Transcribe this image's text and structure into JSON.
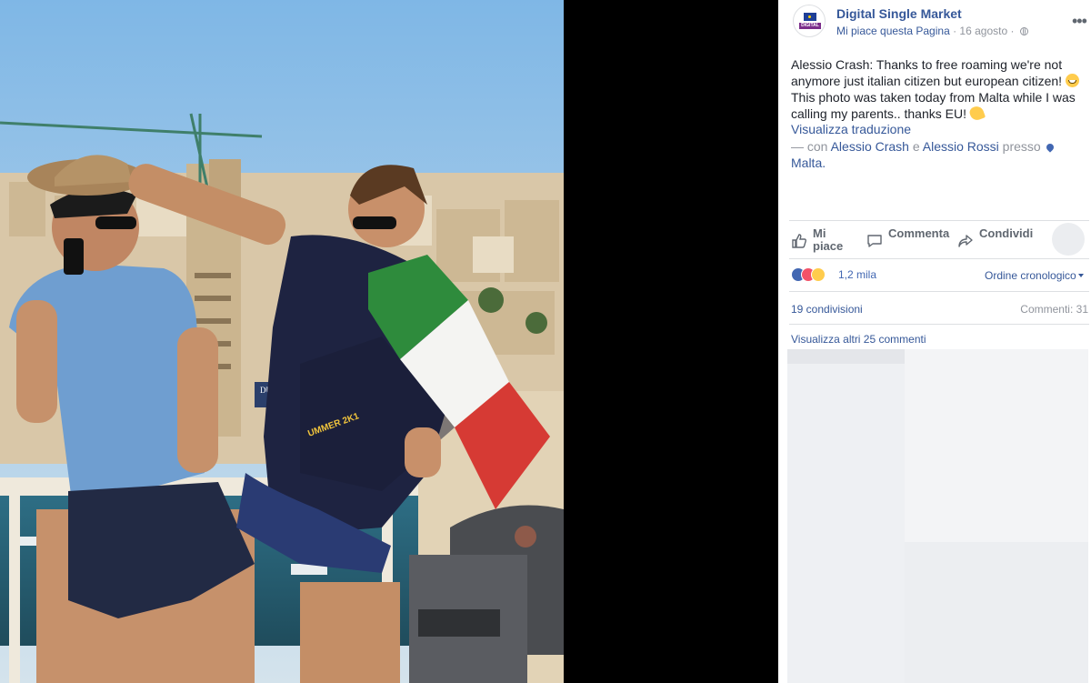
{
  "page": {
    "name": "Digital Single Market",
    "like_page": "Mi piace questa Pagina",
    "separator": " · ",
    "date": "16 agosto",
    "date_separator": " · ",
    "avatar_word": "DIGITAL"
  },
  "post": {
    "line1": "Alessio Crash: Thanks to free roaming we're not anymore just italian citizen but european citizen!",
    "line2": " This photo was taken today from Malta while I was calling my parents.. thanks EU! ",
    "translate": "Visualizza traduzione",
    "with_prefix": " — con ",
    "tag1": "Alessio Crash",
    "and": " e ",
    "tag2": "Alessio Rossi",
    "at": " presso ",
    "place": "Malta."
  },
  "actions": {
    "like": "Mi piace",
    "comment": "Commenta",
    "share": "Condividi"
  },
  "stats": {
    "reactions": "1,2 mila",
    "order": "Ordine cronologico",
    "shares": "19 condivisioni",
    "comments": "Commenti: 31",
    "view_more": "Visualizza altri 25 commenti"
  },
  "photo": {
    "building_sign": "DUBLINE",
    "shirt_text": "UMMER 2K1"
  },
  "colors": {
    "link": "#365899",
    "accent": "#4267b2",
    "muted": "#90949c",
    "text": "#1d2129"
  },
  "icons": [
    "more-icon",
    "globe-icon",
    "pin-icon",
    "like-icon",
    "comment-icon",
    "share-icon"
  ]
}
